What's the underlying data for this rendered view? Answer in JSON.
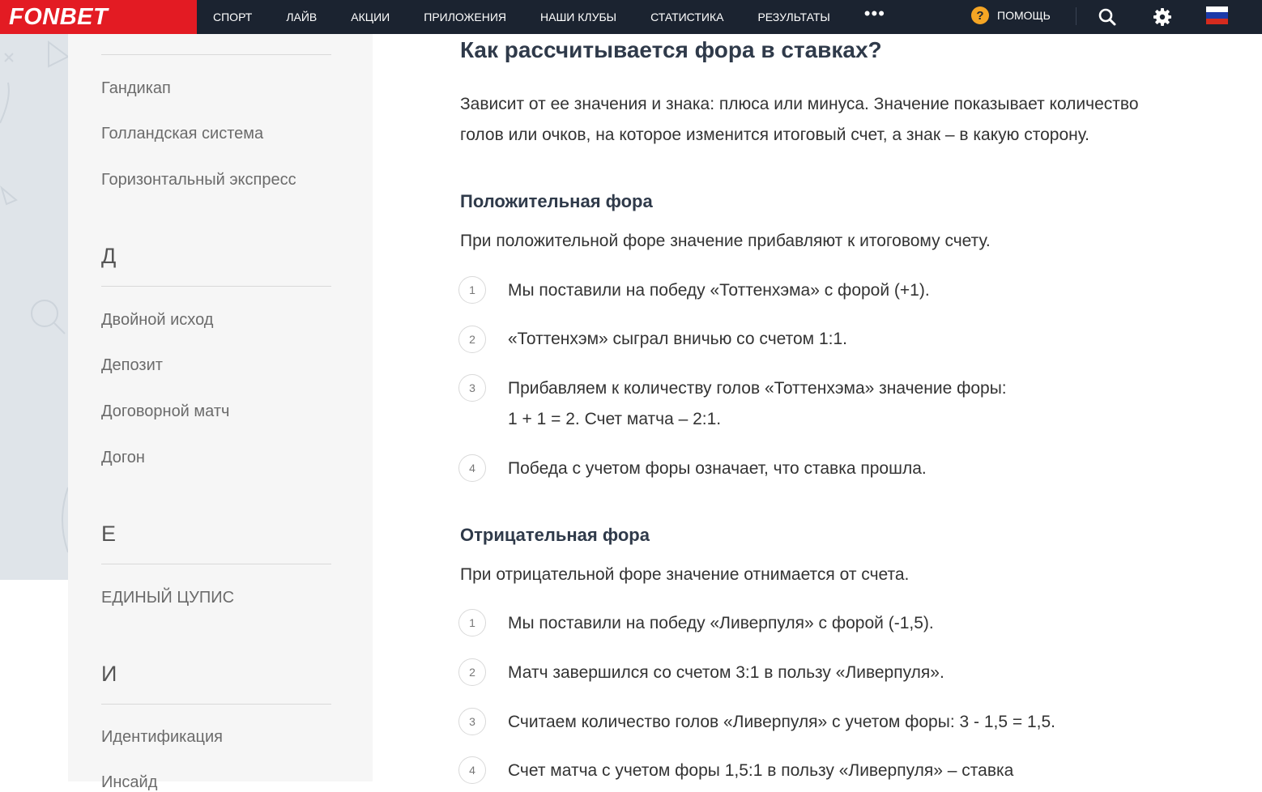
{
  "header": {
    "logo": "FONBET",
    "nav": [
      "СПОРТ",
      "ЛАЙВ",
      "АКЦИИ",
      "ПРИЛОЖЕНИЯ",
      "НАШИ КЛУБЫ",
      "СТАТИСТИКА",
      "РЕЗУЛЬТАТЫ"
    ],
    "more": "•••",
    "help_icon": "?",
    "help_label": "ПОМОЩЬ",
    "icons": [
      "search-icon",
      "gear-icon",
      "flag-russia-icon"
    ]
  },
  "sidebar": {
    "items_g": [
      "Гандикап",
      "Голландская система",
      "Горизонтальный экспресс"
    ],
    "letter_d": "Д",
    "items_d": [
      "Двойной исход",
      "Депозит",
      "Договорной матч",
      "Догон"
    ],
    "letter_e": "Е",
    "items_e": [
      "ЕДИНЫЙ ЦУПИС"
    ],
    "letter_i": "И",
    "items_i": [
      "Идентификация",
      "Инсайд"
    ]
  },
  "article": {
    "title": "Как рассчитывается фора в ставках?",
    "intro_1": "Зависит от ее значения и знака: плюса или минуса. Значение показывает количество",
    "intro_2": "голов или очков, на которое изменится итоговый счет, а знак – в какую сторону.",
    "positive": {
      "heading": "Положительная фора",
      "text": "При положительной форе значение прибавляют к итоговому счету.",
      "steps": [
        {
          "num": "1",
          "lines": [
            "Мы поставили на победу «Тоттенхэма» с форой (+1)."
          ]
        },
        {
          "num": "2",
          "lines": [
            "«Тоттенхэм» сыграл вничью со счетом 1:1."
          ]
        },
        {
          "num": "3",
          "lines": [
            "Прибавляем к количеству голов «Тоттенхэма» значение форы:",
            "1 + 1 = 2. Счет матча – 2:1."
          ]
        },
        {
          "num": "4",
          "lines": [
            "Победа с учетом форы означает, что ставка прошла."
          ]
        }
      ]
    },
    "negative": {
      "heading": "Отрицательная фора",
      "text": "При отрицательной форе значение отнимается от счета.",
      "steps": [
        {
          "num": "1",
          "lines": [
            "Мы поставили на победу «Ливерпуля» с форой (-1,5)."
          ]
        },
        {
          "num": "2",
          "lines": [
            "Матч завершился со счетом 3:1 в пользу «Ливерпуля»."
          ]
        },
        {
          "num": "3",
          "lines": [
            "Считаем количество голов «Ливерпуля» с учетом форы: 3 - 1,5 = 1,5."
          ]
        },
        {
          "num": "4",
          "lines": [
            "Счет матча с учетом форы 1,5:1 в пользу «Ливерпуля» – ставка"
          ]
        }
      ]
    }
  },
  "colors": {
    "topbar": "#1b2330",
    "logo_bg": "#e31b23",
    "help_icon": "#f5a524",
    "sidebar_bg": "#f6f6f6"
  }
}
